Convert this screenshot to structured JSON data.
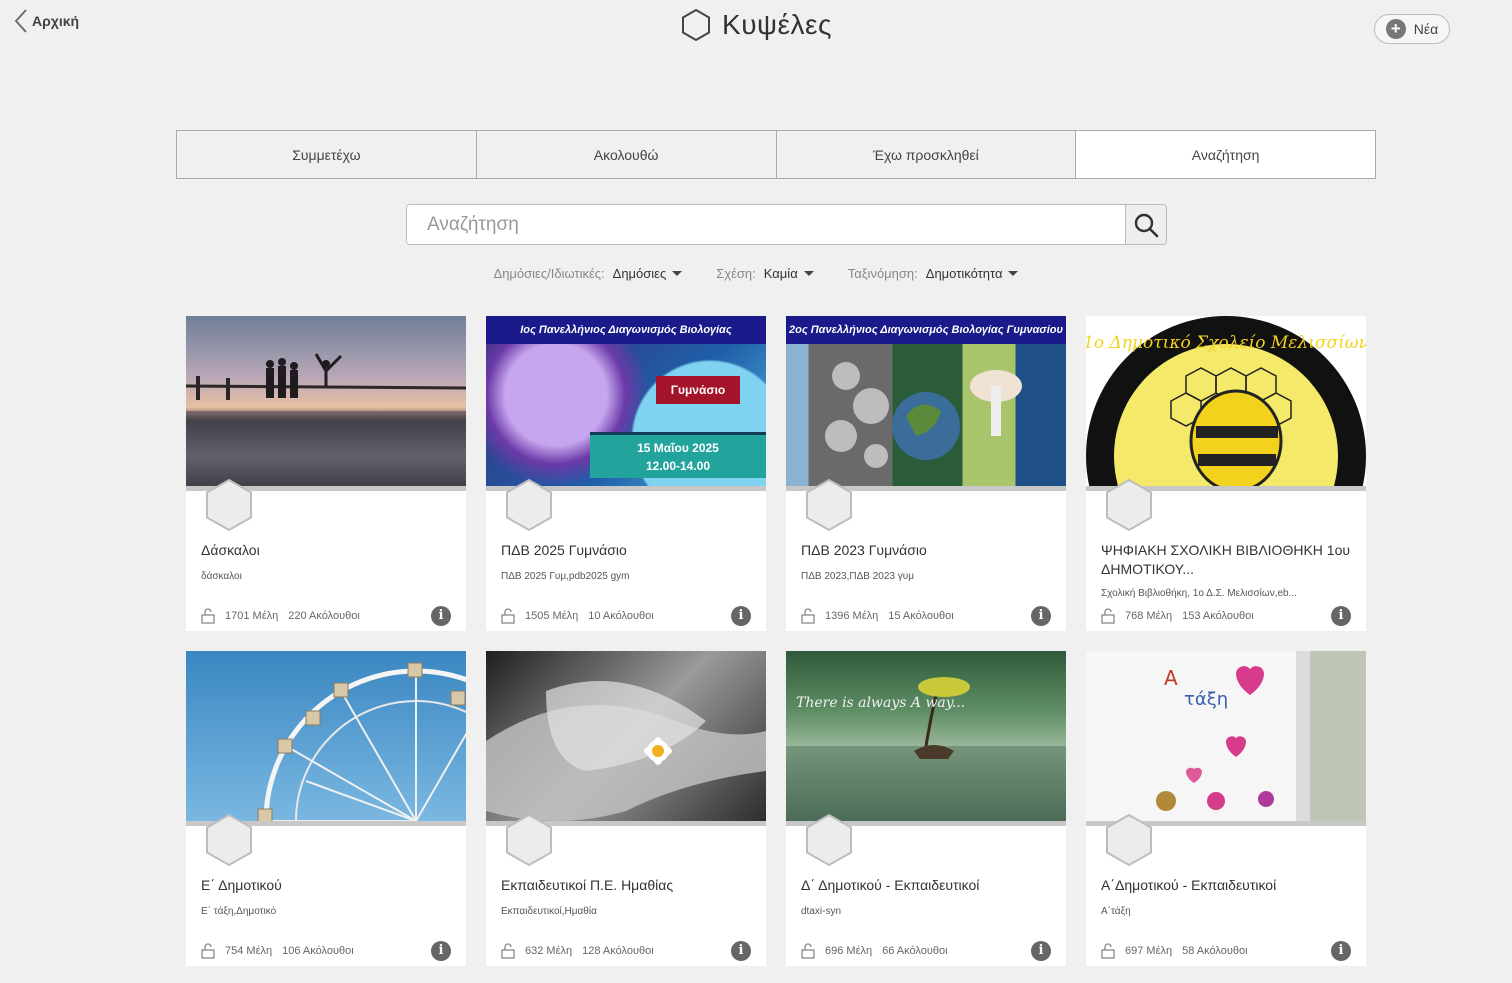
{
  "header": {
    "back_label": "Αρχική",
    "title": "Κυψέλες",
    "new_label": "Νέα"
  },
  "tabs": [
    {
      "label": "Συμμετέχω",
      "active": false
    },
    {
      "label": "Ακολουθώ",
      "active": false
    },
    {
      "label": "Έχω προσκληθεί",
      "active": false
    },
    {
      "label": "Αναζήτηση",
      "active": true
    }
  ],
  "search": {
    "placeholder": "Αναζήτηση",
    "value": ""
  },
  "filters": [
    {
      "label": "Δημόσιες/Ιδιωτικές:",
      "value": "Δημόσιες"
    },
    {
      "label": "Σχέση:",
      "value": "Καμία"
    },
    {
      "label": "Ταξινόμηση:",
      "value": "Δημοτικότητα"
    }
  ],
  "cover_text": {
    "c2_banner": "Ιος Πανελλήνιος Διαγωνισμός Βιολογίας",
    "c2_badge": "Γυμνάσιο",
    "c2_date": "15 Μαΐου 2025",
    "c2_time": "12.00-14.00",
    "c3_banner": "2ος Πανελλήνιος Διαγωνισμός Βιολογίας Γυμνασίου",
    "c4_logo": "1ο Δημοτικό Σχολείο Μελισσίων",
    "c7_caption": "There is always A way..."
  },
  "cards": [
    {
      "title": "Δάσκαλοι",
      "tags": "δάσκαλοι",
      "members": "1701 Μέλη",
      "followers": "220 Ακόλουθοι"
    },
    {
      "title": "ΠΔΒ 2025 Γυμνάσιο",
      "tags": "ΠΔΒ 2025 Γυμ,pdb2025 gym",
      "members": "1505 Μέλη",
      "followers": "10 Ακόλουθοι"
    },
    {
      "title": "ΠΔΒ 2023 Γυμνάσιο",
      "tags": "ΠΔΒ 2023,ΠΔΒ 2023 γυμ",
      "members": "1396 Μέλη",
      "followers": "15 Ακόλουθοι"
    },
    {
      "title": "ΨΗΦΙΑΚΗ ΣΧΟΛΙΚΗ ΒΙΒΛΙΟΘΗΚΗ 1ου ΔΗΜΟΤΙΚΟΥ...",
      "tags": "Σχολική Βιβλιοθήκη, 1ο Δ.Σ. Μελισσίων,eb...",
      "members": "768 Μέλη",
      "followers": "153 Ακόλουθοι"
    },
    {
      "title": "Ε΄ Δημοτικού",
      "tags": "Ε΄ τάξη,Δημοτικό",
      "members": "754 Μέλη",
      "followers": "106 Ακόλουθοι"
    },
    {
      "title": "Εκπαιδευτικοί Π.Ε. Ημαθίας",
      "tags": "Εκπαιδευτικοί,Ημαθία",
      "members": "632 Μέλη",
      "followers": "128 Ακόλουθοι"
    },
    {
      "title": "Δ΄ Δημοτικού - Εκπαιδευτικοί",
      "tags": "dtaxi-syn",
      "members": "696 Μέλη",
      "followers": "66 Ακόλουθοι"
    },
    {
      "title": "Α΄Δημοτικού - Εκπαιδευτικοί",
      "tags": "Α΄τάξη",
      "members": "697 Μέλη",
      "followers": "58 Ακόλουθοι"
    }
  ]
}
